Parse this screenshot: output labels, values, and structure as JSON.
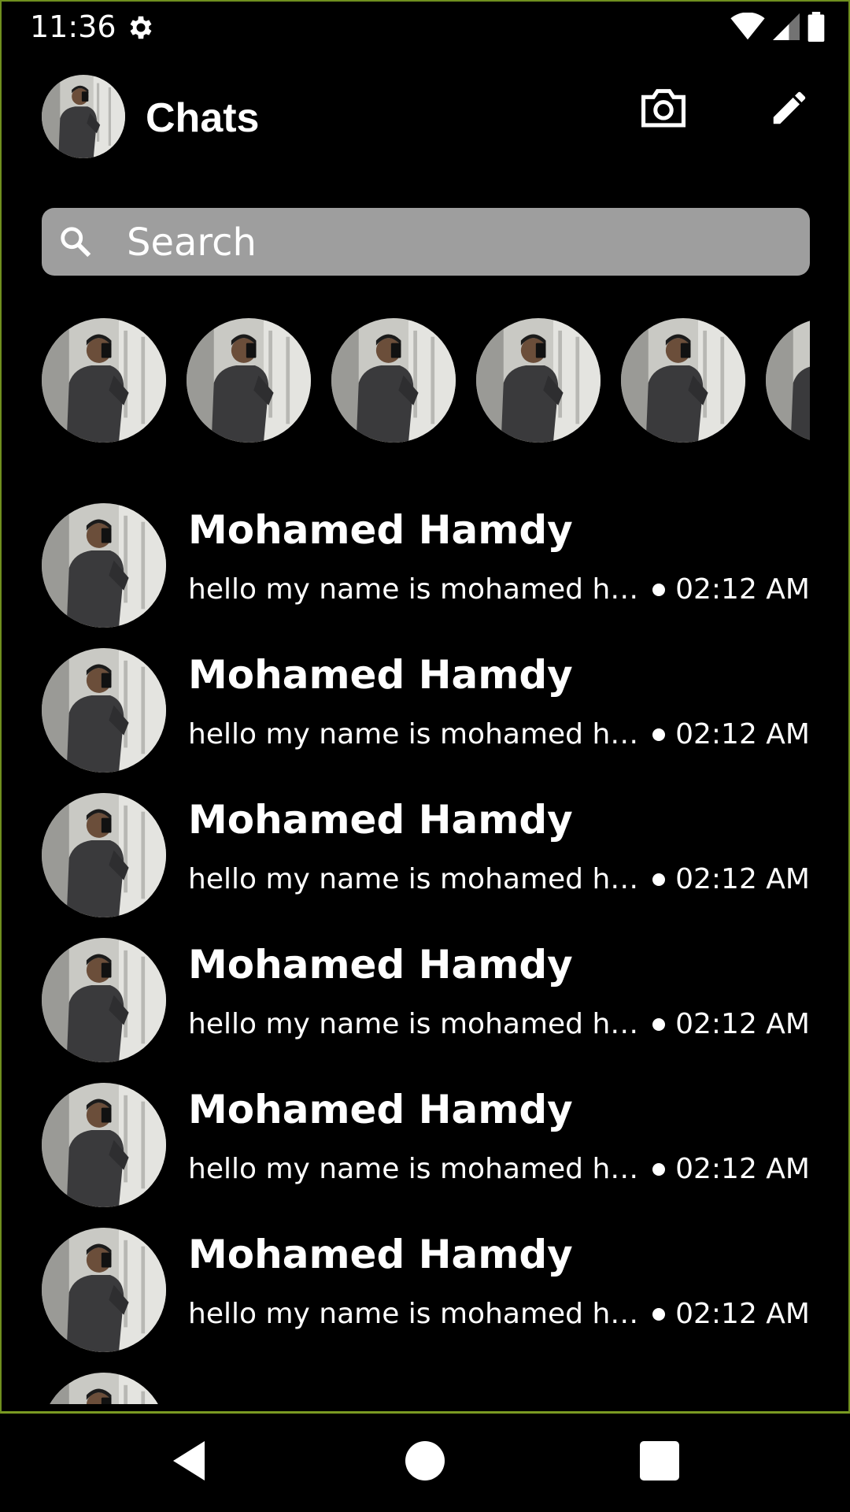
{
  "status_bar": {
    "time": "11:36",
    "icons": [
      "settings-icon",
      "wifi-icon",
      "signal-icon",
      "battery-icon"
    ]
  },
  "header": {
    "title": "Chats",
    "actions": [
      "camera-icon",
      "pencil-icon"
    ]
  },
  "search": {
    "placeholder": "Search"
  },
  "stories": {
    "count": 6
  },
  "chats": [
    {
      "name": "Mohamed Hamdy",
      "message": "hello my name is mohamed hello my name is mohamed",
      "time": "02:12 AM"
    },
    {
      "name": "Mohamed Hamdy",
      "message": "hello my name is mohamed hello my name is mohamed",
      "time": "02:12 AM"
    },
    {
      "name": "Mohamed Hamdy",
      "message": "hello my name is mohamed hello my name is mohamed",
      "time": "02:12 AM"
    },
    {
      "name": "Mohamed Hamdy",
      "message": "hello my name is mohamed hello my name is mohamed",
      "time": "02:12 AM"
    },
    {
      "name": "Mohamed Hamdy",
      "message": "hello my name is mohamed hello my name is mohamed",
      "time": "02:12 AM"
    },
    {
      "name": "Mohamed Hamdy",
      "message": "hello my name is mohamed hello my name is mohamed",
      "time": "02:12 AM"
    }
  ],
  "nav": {
    "buttons": [
      "back-icon",
      "home-icon",
      "recents-icon"
    ]
  },
  "colors": {
    "background": "#000000",
    "search_bg": "#9e9e9e",
    "frame_border": "#6f8f1e",
    "text": "#ffffff"
  }
}
